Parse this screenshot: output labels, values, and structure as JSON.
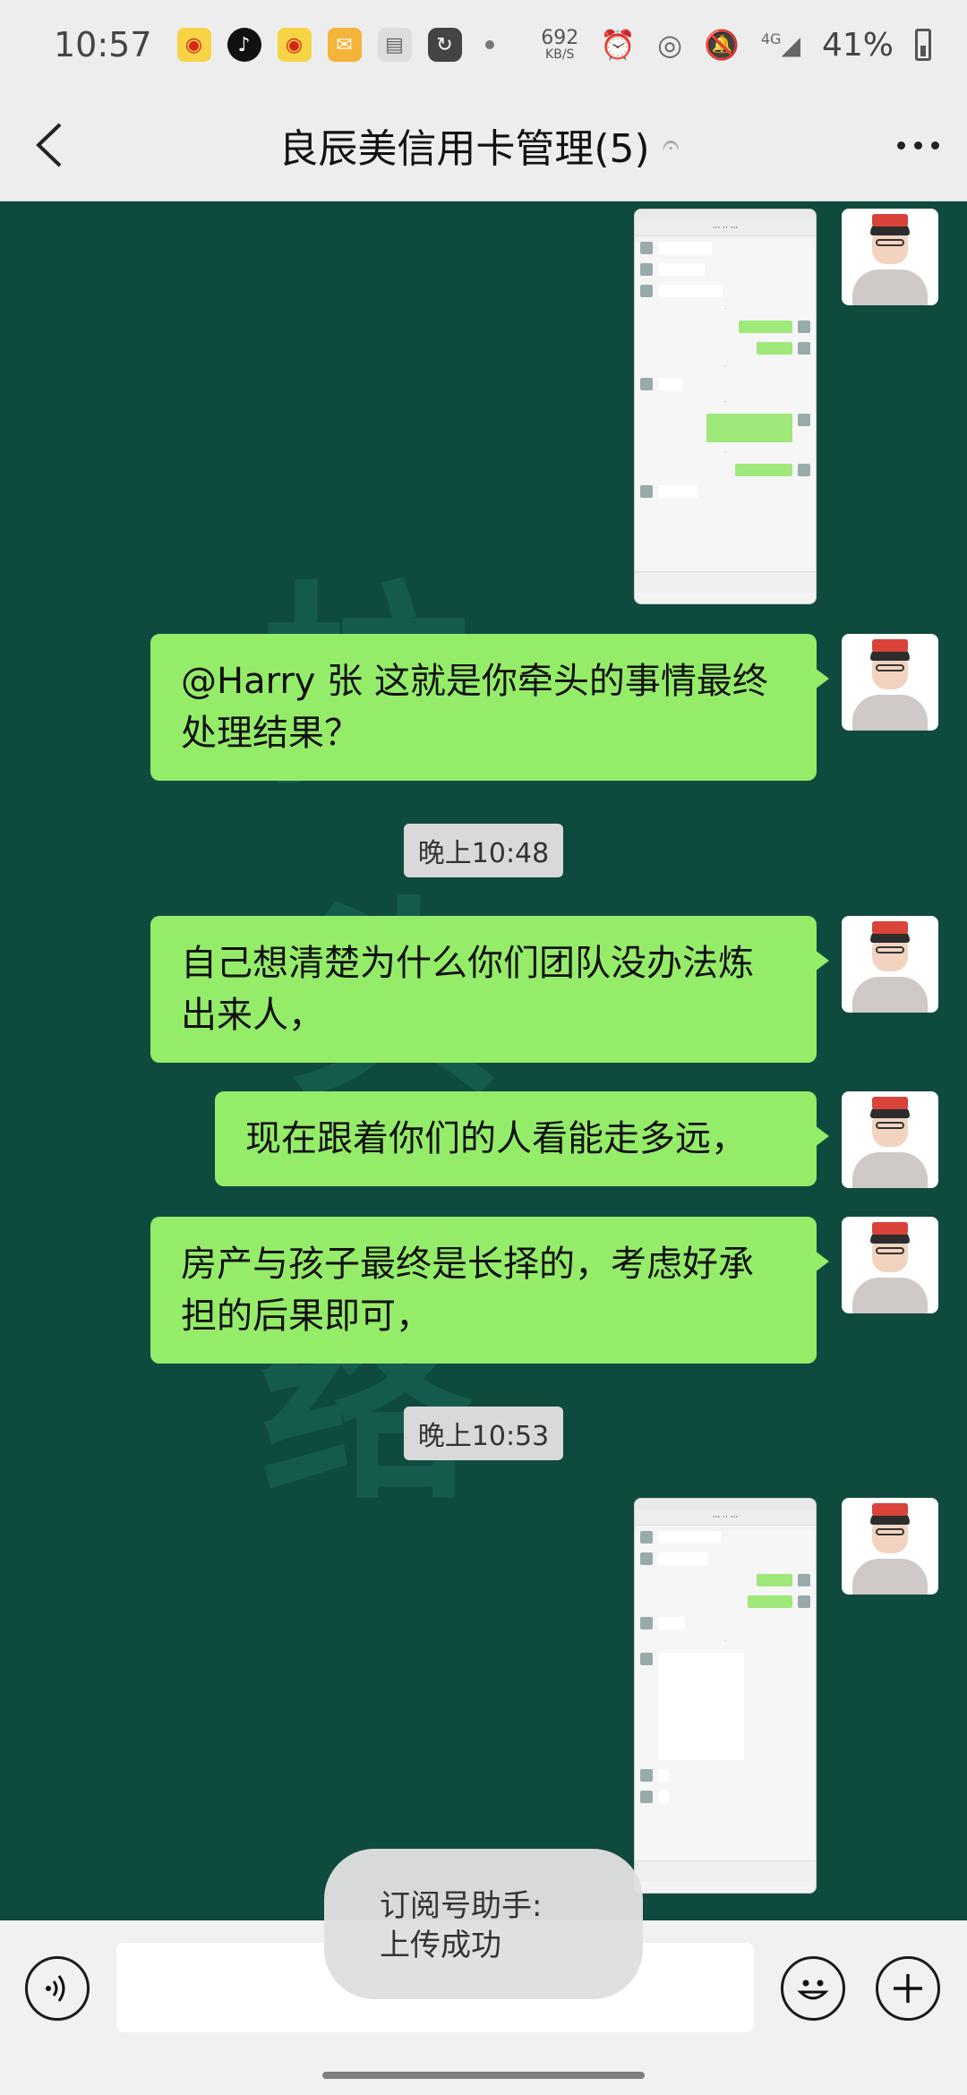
{
  "status_bar": {
    "time": "10:57",
    "net_speed": "692",
    "net_unit": "KB/S",
    "network": "4G",
    "battery": "41%"
  },
  "header": {
    "title": "良辰美信用卡管理(5)"
  },
  "messages": [
    {
      "type": "image",
      "id": "img1"
    },
    {
      "type": "text",
      "text": "@Harry 张  这就是你牵头的事情最终处理结果？"
    },
    {
      "type": "time",
      "text": "晚上10:48"
    },
    {
      "type": "text",
      "text": "自己想清楚为什么你们团队没办法炼出来人，"
    },
    {
      "type": "text",
      "text": "现在跟着你们的人看能走多远，"
    },
    {
      "type": "text",
      "text": "房产与孩子最终是长择的，考虑好承担的后果即可，"
    },
    {
      "type": "time",
      "text": "晚上10:53"
    },
    {
      "type": "image",
      "id": "img2"
    }
  ],
  "toast": {
    "line1": "订阅号助手:",
    "line2": "上传成功"
  },
  "icons": {
    "back": "back-chevron-icon",
    "more": "more-dots-icon",
    "voice": "voice-icon",
    "emoji": "emoji-icon",
    "plus": "plus-icon"
  },
  "colors": {
    "bubble": "#95ec69",
    "chat_bg": "#0f4a3e",
    "header_bg": "#ededed"
  }
}
